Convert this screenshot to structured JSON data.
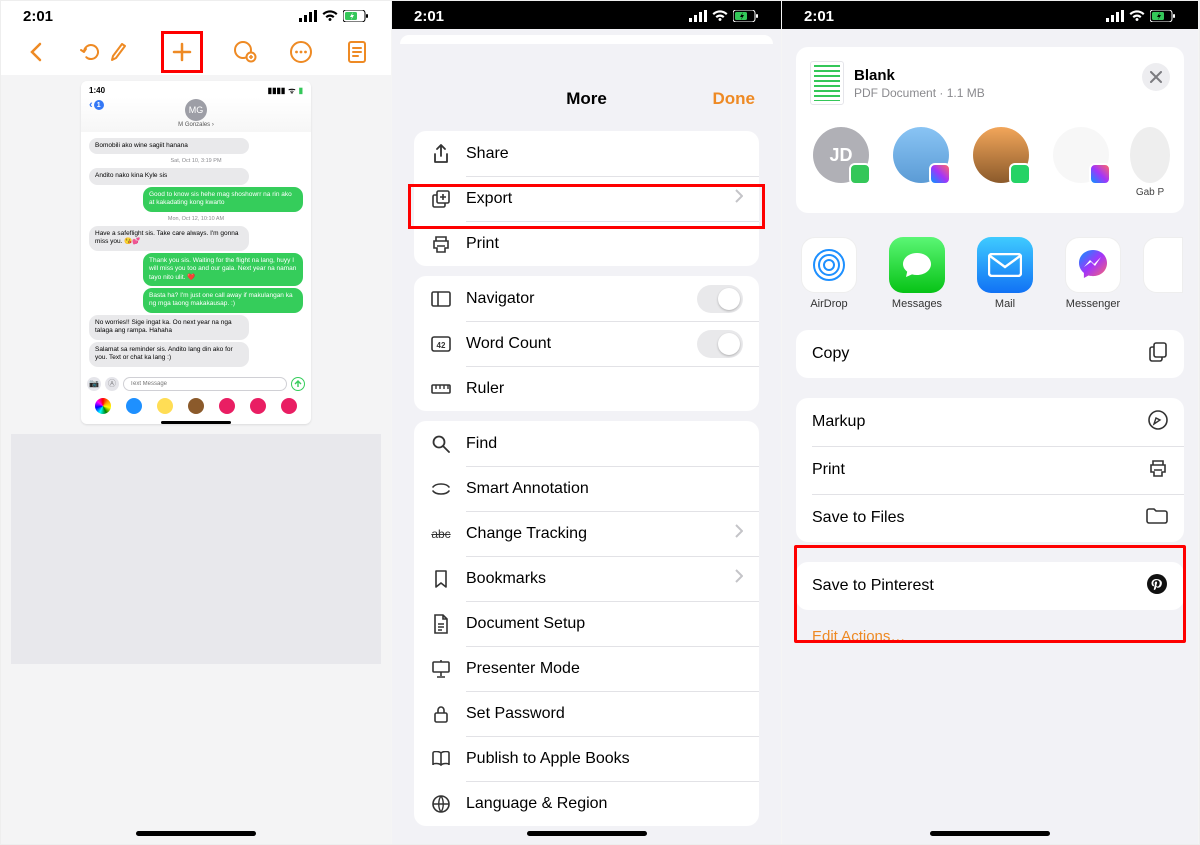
{
  "status": {
    "time": "2:01"
  },
  "phone1": {
    "inner": {
      "time": "1:40",
      "back_badge": "1",
      "avatar_initials": "MG",
      "contact": "M Gonzales ›",
      "m1": "Bomobili ako wine sagiit hanana",
      "ts1": "Sat, Oct 10, 3:19 PM",
      "m2": "Andito nako kina Kyle sis",
      "m3": "Good to know sis hehe mag shoshowrr na rin ako at kakadating kong kwarto",
      "ts2": "Mon, Oct 12, 10:10 AM",
      "m4": "Have a safeflight sis. Take care always. I'm gonna miss you. 😘💕",
      "m5": "Thank you sis. Waiting for the flight na lang, huyy I will miss you too and our gala. Next year na naman tayo nito ulit. ❤️",
      "m6": "Basta ha? I'm just one call away if makulangan ka ng mga taong makakausap. :)",
      "m7": "No worries!! Sige ingat ka. Oo next year na nga talaga ang rampa. Hahaha",
      "m8": "Salamat sa reminder sis. Andito lang din ako for you. Text or chat ka lang :)",
      "placeholder": "Text Message"
    }
  },
  "phone2": {
    "title": "More",
    "done": "Done",
    "group1": {
      "a": "Share",
      "b": "Export",
      "c": "Print"
    },
    "group2": {
      "a": "Navigator",
      "b": "Word Count",
      "c": "Ruler"
    },
    "group3": {
      "a": "Find",
      "b": "Smart Annotation",
      "c": "Change Tracking",
      "d": "Bookmarks",
      "e": "Document Setup",
      "f": "Presenter Mode",
      "g": "Set Password",
      "h": "Publish to Apple Books",
      "i": "Language & Region"
    }
  },
  "phone3": {
    "doc_title": "Blank",
    "doc_sub": "PDF Document · 1.1 MB",
    "people": [
      {
        "initials": "JD",
        "badge": "#34C759",
        "name": ""
      },
      {
        "initials": "",
        "badge": "#A033FF",
        "name": ""
      },
      {
        "initials": "",
        "badge": "#25D366",
        "name": ""
      },
      {
        "initials": "",
        "badge": "#A033FF",
        "name": ""
      },
      {
        "initials": "",
        "badge": "",
        "name": "Gab P"
      }
    ],
    "apps": {
      "a": "AirDrop",
      "b": "Messages",
      "c": "Mail",
      "d": "Messenger"
    },
    "act": {
      "copy": "Copy",
      "markup": "Markup",
      "print": "Print",
      "save": "Save to Files",
      "pin": "Save to Pinterest"
    },
    "edit": "Edit Actions…"
  }
}
